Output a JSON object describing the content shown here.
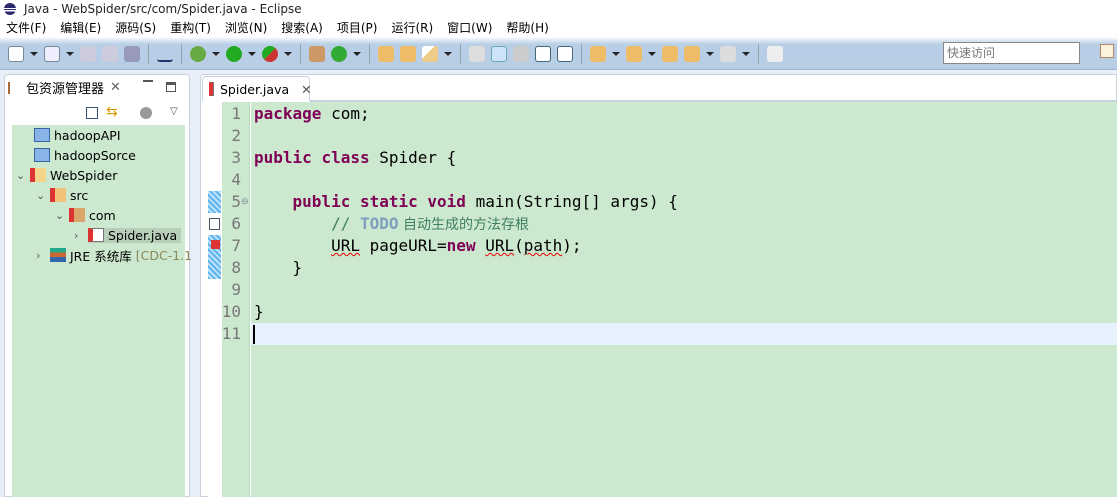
{
  "window": {
    "title": "Java  -  WebSpider/src/com/Spider.java  -  Eclipse"
  },
  "menu": [
    "文件(F)",
    "编辑(E)",
    "源码(S)",
    "重构(T)",
    "浏览(N)",
    "搜索(A)",
    "项目(P)",
    "运行(R)",
    "窗口(W)",
    "帮助(H)"
  ],
  "toolbar": {
    "quick_access_placeholder": "快速访问"
  },
  "package_explorer": {
    "title": "包资源管理器",
    "tree": [
      {
        "label": "hadoopAPI",
        "suffix": ""
      },
      {
        "label": "hadoopSorce",
        "suffix": ""
      },
      {
        "label": "WebSpider",
        "suffix": ""
      },
      {
        "label": "src",
        "suffix": ""
      },
      {
        "label": "com",
        "suffix": ""
      },
      {
        "label": "Spider.java",
        "suffix": ""
      },
      {
        "label": "JRE 系统库",
        "suffix": "[CDC-1.1"
      }
    ]
  },
  "editor": {
    "tab_label": "Spider.java",
    "line_numbers": [
      "1",
      "2",
      "3",
      "4",
      "5",
      "6",
      "7",
      "8",
      "9",
      "10",
      "11"
    ],
    "code": {
      "l1_kw": "package",
      "l1_rest": " com;",
      "l3_kw1": "public",
      "l3_kw2": "class",
      "l3_rest": " Spider {",
      "l5_kw1": "public",
      "l5_kw2": "static",
      "l5_kw3": "void",
      "l5_rest": " main(String[] args) {",
      "l6_slash": "// ",
      "l6_todo": "TODO",
      "l6_text": " 自动生成的方法存根",
      "l7_url1": "URL",
      "l7_mid": " pageURL=",
      "l7_kw": "new",
      "l7_url2": "URL",
      "l7_paren": "(",
      "l7_path": "path",
      "l7_end": ");",
      "l8": "    }",
      "l10": "}"
    }
  },
  "colors": {
    "editor_bg": "#cce8cf",
    "keyword": "#7f0055",
    "comment": "#3f7f5f",
    "current_line": "#e8f2fe"
  }
}
